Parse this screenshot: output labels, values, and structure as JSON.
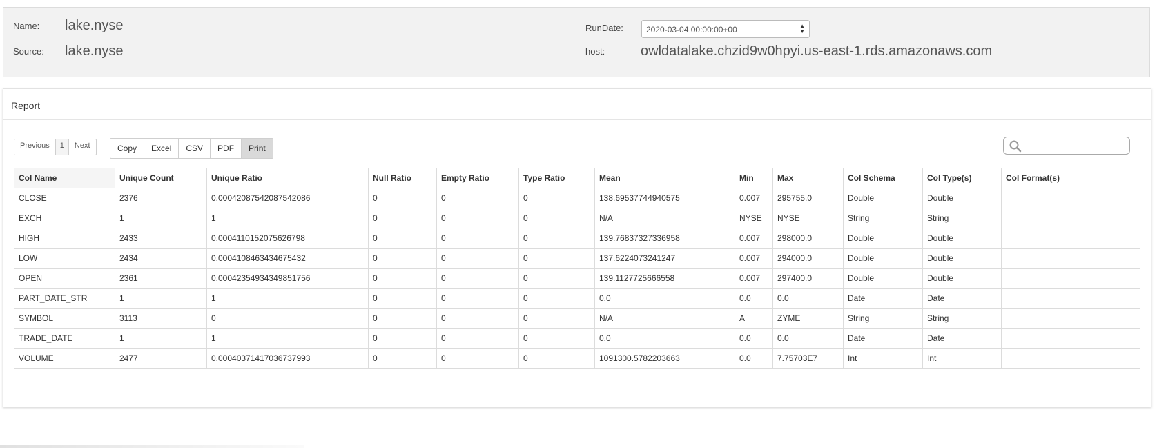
{
  "header": {
    "name_label": "Name:",
    "name_value": "lake.nyse",
    "source_label": "Source:",
    "source_value": "lake.nyse",
    "rundate_label": "RunDate:",
    "rundate_value": "2020-03-04 00:00:00+00",
    "host_label": "host:",
    "host_value": "owldatalake.chzid9w0hpyi.us-east-1.rds.amazonaws.com"
  },
  "report": {
    "title": "Report",
    "pager": {
      "previous": "Previous",
      "page": "1",
      "next": "Next"
    },
    "export": [
      "Copy",
      "Excel",
      "CSV",
      "PDF",
      "Print"
    ],
    "search": {
      "icon": "search-icon",
      "placeholder": ""
    },
    "columns": [
      "Col Name",
      "Unique Count",
      "Unique Ratio",
      "Null Ratio",
      "Empty Ratio",
      "Type Ratio",
      "Mean",
      "Min",
      "Max",
      "Col Schema",
      "Col Type(s)",
      "Col Format(s)"
    ],
    "rows": [
      [
        "CLOSE",
        "2376",
        "0.00042087542087542086",
        "0",
        "0",
        "0",
        "138.69537744940575",
        "0.007",
        "295755.0",
        "Double",
        "Double",
        ""
      ],
      [
        "EXCH",
        "1",
        "1",
        "0",
        "0",
        "0",
        "N/A",
        "NYSE",
        "NYSE",
        "String",
        "String",
        ""
      ],
      [
        "HIGH",
        "2433",
        "0.0004110152075626798",
        "0",
        "0",
        "0",
        "139.76837327336958",
        "0.007",
        "298000.0",
        "Double",
        "Double",
        ""
      ],
      [
        "LOW",
        "2434",
        "0.0004108463434675432",
        "0",
        "0",
        "0",
        "137.6224073241247",
        "0.007",
        "294000.0",
        "Double",
        "Double",
        ""
      ],
      [
        "OPEN",
        "2361",
        "0.00042354934349851756",
        "0",
        "0",
        "0",
        "139.1127725666558",
        "0.007",
        "297400.0",
        "Double",
        "Double",
        ""
      ],
      [
        "PART_DATE_STR",
        "1",
        "1",
        "0",
        "0",
        "0",
        "0.0",
        "0.0",
        "0.0",
        "Date",
        "Date",
        ""
      ],
      [
        "SYMBOL",
        "3113",
        "0",
        "0",
        "0",
        "0",
        "N/A",
        "A",
        "ZYME",
        "String",
        "String",
        ""
      ],
      [
        "TRADE_DATE",
        "1",
        "1",
        "0",
        "0",
        "0",
        "0.0",
        "0.0",
        "0.0",
        "Date",
        "Date",
        ""
      ],
      [
        "VOLUME",
        "2477",
        "0.00040371417036737993",
        "0",
        "0",
        "0",
        "1091300.5782203663",
        "0.0",
        "7.75703E7",
        "Int",
        "Int",
        ""
      ]
    ]
  }
}
